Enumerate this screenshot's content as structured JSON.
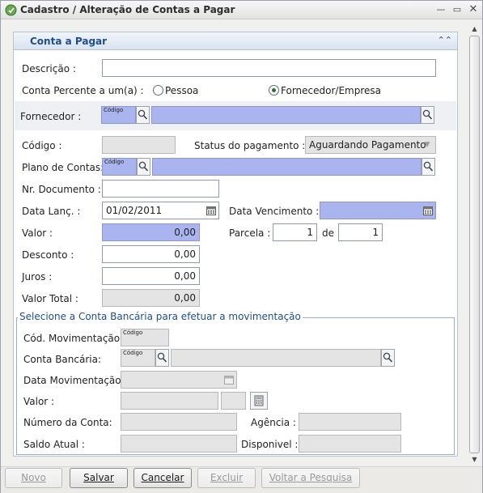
{
  "window": {
    "title": "Cadastro / Alteração de Contas a Pagar"
  },
  "panel": {
    "title": "Conta a Pagar"
  },
  "form": {
    "descricao_label": "Descrição :",
    "descricao_value": "",
    "conta_percente_label": "Conta Percente a um(a) :",
    "radio_pessoa": "Pessoa",
    "radio_fornecedor": "Fornecedor/Empresa",
    "radio_selected": "Fornecedor/Empresa",
    "fornecedor_label": "Fornecedor :",
    "codigo_tag": "Código",
    "codigo_label": "Código :",
    "status_label": "Status do pagamento :",
    "status_value": "Aguardando Pagamento",
    "plano_label": "Plano de Contas:",
    "nr_documento_label": "Nr. Documento :",
    "data_lanc_label": "Data Lanç. :",
    "data_lanc_value": "01/02/2011",
    "data_venc_label": "Data Vencimento :",
    "valor_label": "Valor :",
    "valor_value": "0,00",
    "parcela_label": "Parcela :",
    "parcela_value": "1",
    "de_label": "de",
    "de_value": "1",
    "desconto_label": "Desconto :",
    "desconto_value": "0,00",
    "juros_label": "Juros :",
    "juros_value": "0,00",
    "valor_total_label": "Valor Total :",
    "valor_total_value": "0,00"
  },
  "bank": {
    "legend": "Selecione a Conta Bancária para efetuar a movimentação",
    "cod_mov_label": "Cód. Movimentação:",
    "conta_bancaria_label": "Conta Bancária:",
    "data_mov_label": "Data Movimentação:",
    "valor_label": "Valor :",
    "numero_conta_label": "Número da Conta:",
    "agencia_label": "Agência :",
    "saldo_label": "Saldo Atual :",
    "disponivel_label": "Disponivel :"
  },
  "buttons": {
    "novo": "Novo",
    "salvar": "Salvar",
    "cancelar": "Cancelar",
    "excluir": "Excluir",
    "voltar": "Voltar a Pesquisa"
  },
  "colors": {
    "required_field": "#aab4ee",
    "accent": "#1f4e8c"
  },
  "icons": [
    "app-icon",
    "minimize-icon",
    "maximize-icon",
    "close-icon",
    "collapse-icon",
    "search-icon",
    "calendar-icon",
    "calculator-icon",
    "scroll-up-icon",
    "scroll-down-icon"
  ]
}
